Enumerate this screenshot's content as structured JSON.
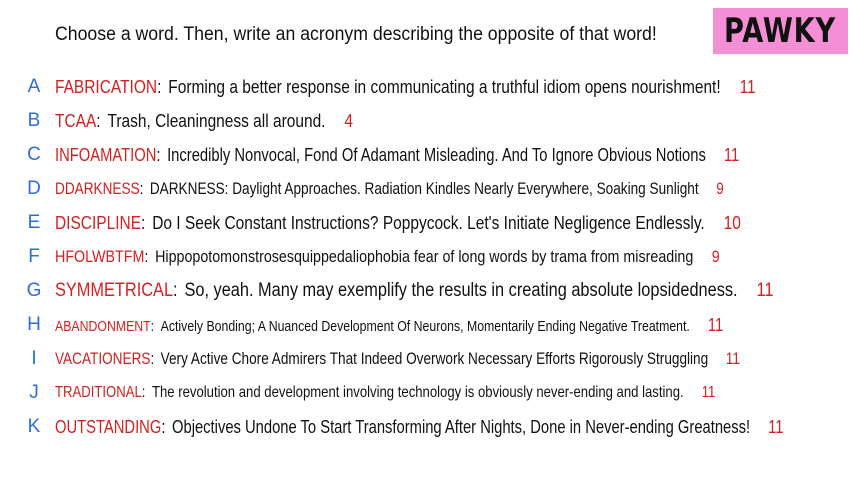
{
  "prompt": "Choose a word. Then, write an acronym describing the opposite of that word!",
  "brand": "PAWKY",
  "rows": [
    {
      "letter": "A",
      "word": "FABRICATION",
      "acronym": "Forming a better response in communicating a truthful idiom opens nourishment!",
      "count": "11"
    },
    {
      "letter": "B",
      "word": "TCAA",
      "acronym": "Trash, Cleaningness all around.",
      "count": "4"
    },
    {
      "letter": "C",
      "word": "INFOAMATION",
      "acronym": "Incredibly Nonvocal, Fond Of Adamant Misleading. And To Ignore Obvious Notions",
      "count": "11"
    },
    {
      "letter": "D",
      "word": "DDARKNESS",
      "acronym": "DARKNESS: Daylight Approaches. Radiation Kindles Nearly Everywhere, Soaking Sunlight",
      "count": "9"
    },
    {
      "letter": "E",
      "word": "DISCIPLINE",
      "acronym": "Do I Seek Constant Instructions? Poppycock. Let's Initiate Negligence Endlessly.",
      "count": "10"
    },
    {
      "letter": "F",
      "word": "HFOLWBTFM",
      "acronym": "Hippopotomonstrosesquippedaliophobia fear of long words by trama from misreading",
      "count": "9"
    },
    {
      "letter": "G",
      "word": "SYMMETRICAL",
      "acronym": "So, yeah. Many may exemplify the results in creating absolute lopsidedness.",
      "count": "11"
    },
    {
      "letter": "H",
      "word": "ABANDONMENT",
      "acronym": "Actively Bonding; A Nuanced Development Of Neurons, Momentarily Ending Negative Treatment.",
      "count": "11"
    },
    {
      "letter": "I",
      "word": "VACATIONERS",
      "acronym": "Very Active Chore Admirers That Indeed Overwork Necessary Efforts Rigorously Struggling",
      "count": "11"
    },
    {
      "letter": "J",
      "word": "TRADITIONAL",
      "acronym": "The revolution and development involving technology is obviously never-ending and lasting.",
      "count": "11"
    },
    {
      "letter": "K",
      "word": "OUTSTANDING",
      "acronym": "Objectives Undone To Start Transforming After Nights, Done in Never-ending Greatness!",
      "count": "11"
    }
  ]
}
